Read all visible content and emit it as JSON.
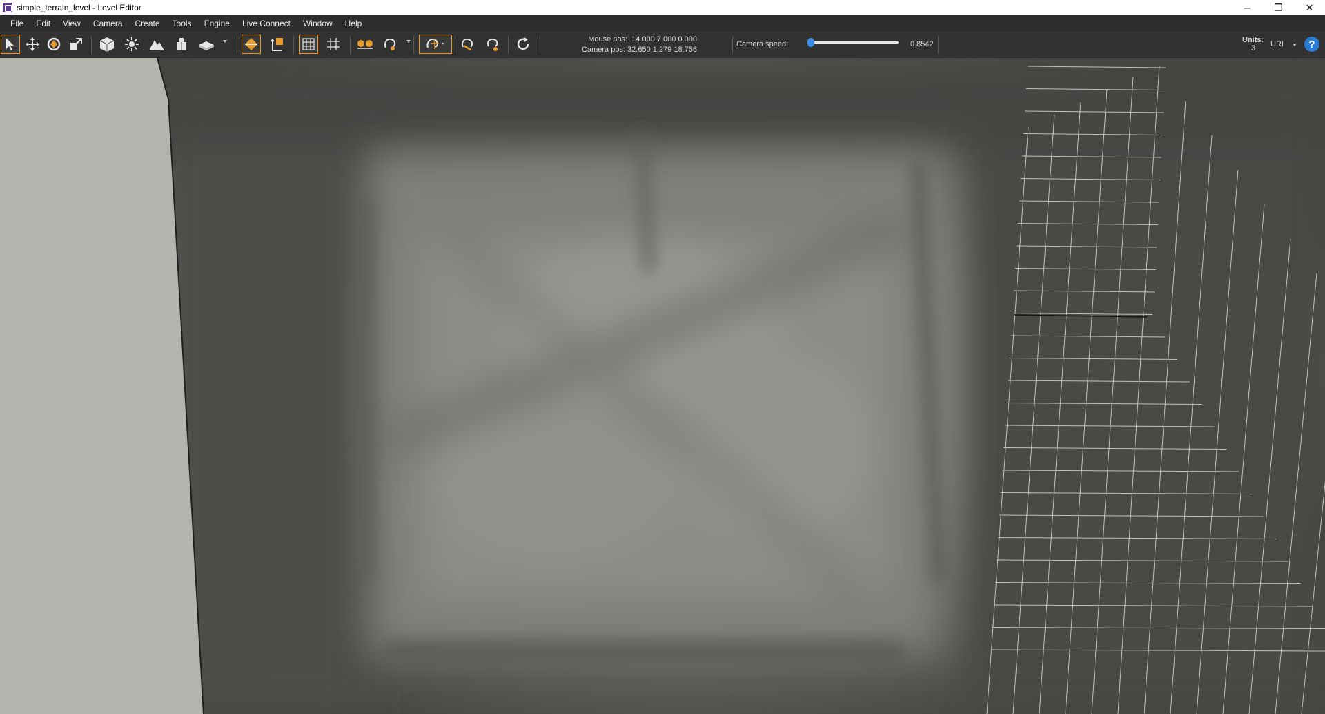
{
  "window": {
    "title": "simple_terrain_level - Level Editor",
    "controls": {
      "minimize": "─",
      "restore": "❐",
      "close": "✕"
    }
  },
  "menubar": {
    "items": [
      "File",
      "Edit",
      "View",
      "Camera",
      "Create",
      "Tools",
      "Engine",
      "Live Connect",
      "Window",
      "Help"
    ]
  },
  "toolbar": {
    "mouse_pos_label": "Mouse pos:",
    "mouse_pos_value": "14.000 7.000 0.000",
    "camera_pos_label": "Camera pos:",
    "camera_pos_value": "32.650 1.279 18.756",
    "camera_speed_label": "Camera speed:",
    "camera_speed_value": "0.8542",
    "camera_speed_fraction": 0.04,
    "units_label": "Units:",
    "units_value": "3",
    "units_select": "URI",
    "help_label": "?",
    "accent_color": "#e89a2c",
    "slider_color": "#3a8ee6",
    "tools": [
      "select-icon",
      "move-icon",
      "rotate-icon",
      "scale-icon",
      "box-icon",
      "light-icon",
      "terrain-icon",
      "unit-icon",
      "plane-icon",
      "snap-vertex-icon",
      "snap-anchor-icon",
      "grid-local-icon",
      "grid-world-icon",
      "pair-icon",
      "lasso-icon",
      "snap-grid-icon",
      "magnet-icon",
      "refresh-magnet-icon",
      "cycle-icon"
    ]
  }
}
